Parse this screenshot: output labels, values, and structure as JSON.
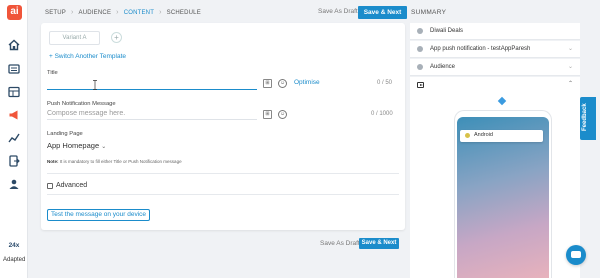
{
  "brand": {
    "logo_text": "ai",
    "accent": "#1b8ccb",
    "logo_color": "#f0553a"
  },
  "sidebar": {
    "icons": [
      "home-icon",
      "campaign-list-icon",
      "dashboard-icon",
      "megaphone-icon",
      "analytics-icon",
      "export-icon",
      "users-icon"
    ],
    "help": {
      "badge": "24x",
      "label": "Adapted"
    }
  },
  "steps": [
    "SETUP",
    "AUDIENCE",
    "CONTENT",
    "SCHEDULE"
  ],
  "active_step": "CONTENT",
  "actions": {
    "save_draft": "Save As Draft",
    "save_next": "Save & Next"
  },
  "form": {
    "variant_tab": "Variant A",
    "switch_template": "+ Switch Another Template",
    "title": {
      "label": "Title",
      "value": "",
      "optimise": "Optimise",
      "counter": "0 / 50"
    },
    "message": {
      "label": "Push Notification Message",
      "placeholder": "Compose message here.",
      "counter": "0 / 1000"
    },
    "landing": {
      "label": "Landing Page",
      "value": "App Homepage"
    },
    "note_prefix": "Note:",
    "note_text": "It is mandatory to fill either Title or Push Notification message",
    "advanced": "Advanced",
    "test_button": "Test the message on your device"
  },
  "summary": {
    "title": "SUMMARY",
    "rows": [
      {
        "text": "Diwali Deals"
      },
      {
        "text": "App push notification - testAppParesh"
      },
      {
        "text": "Audience"
      }
    ],
    "preview": {
      "platform": "Android"
    }
  },
  "feedback": "Feedback"
}
